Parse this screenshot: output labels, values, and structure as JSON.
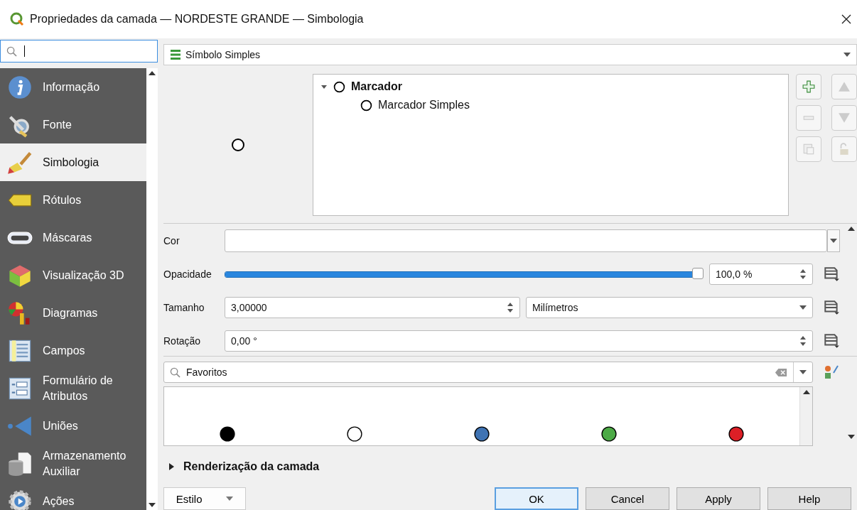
{
  "window": {
    "title": "Propriedades da camada — NORDESTE GRANDE — Simbologia"
  },
  "sidebar": {
    "items": [
      {
        "label": "Informação",
        "selected": false
      },
      {
        "label": "Fonte",
        "selected": false
      },
      {
        "label": "Simbologia",
        "selected": true
      },
      {
        "label": "Rótulos",
        "selected": false
      },
      {
        "label": "Máscaras",
        "selected": false
      },
      {
        "label": "Visualização 3D",
        "selected": false
      },
      {
        "label": "Diagramas",
        "selected": false
      },
      {
        "label": "Campos",
        "selected": false
      },
      {
        "label": "Formulário de Atributos",
        "selected": false
      },
      {
        "label": "Uniões",
        "selected": false
      },
      {
        "label": "Armazenamento Auxiliar",
        "selected": false
      },
      {
        "label": "Ações",
        "selected": false
      }
    ]
  },
  "renderer": {
    "value": "Símbolo Simples"
  },
  "symbol_tree": [
    {
      "label": "Marcador",
      "expanded": true,
      "children": [
        {
          "label": "Marcador Simples"
        }
      ]
    }
  ],
  "form": {
    "color": {
      "label": "Cor"
    },
    "opacity": {
      "label": "Opacidade",
      "level": 1.0,
      "value": "100,0 %"
    },
    "size": {
      "label": "Tamanho",
      "value": "3,00000",
      "unit": "Milímetros"
    },
    "rotation": {
      "label": "Rotação",
      "value": "0,00 °"
    }
  },
  "library": {
    "filter": "Favoritos",
    "symbols": [
      {
        "color": "#000000"
      },
      {
        "color": "#ffffff"
      },
      {
        "color": "#3f73b3"
      },
      {
        "color": "#4caa46"
      },
      {
        "color": "#dc1f26"
      }
    ]
  },
  "section": {
    "label": "Renderização da camada",
    "expanded": false
  },
  "style_button": "Estilo",
  "buttons": [
    {
      "label": "OK",
      "default": true
    },
    {
      "label": "Cancel",
      "default": false
    },
    {
      "label": "Apply",
      "default": false
    },
    {
      "label": "Help",
      "default": false
    }
  ]
}
